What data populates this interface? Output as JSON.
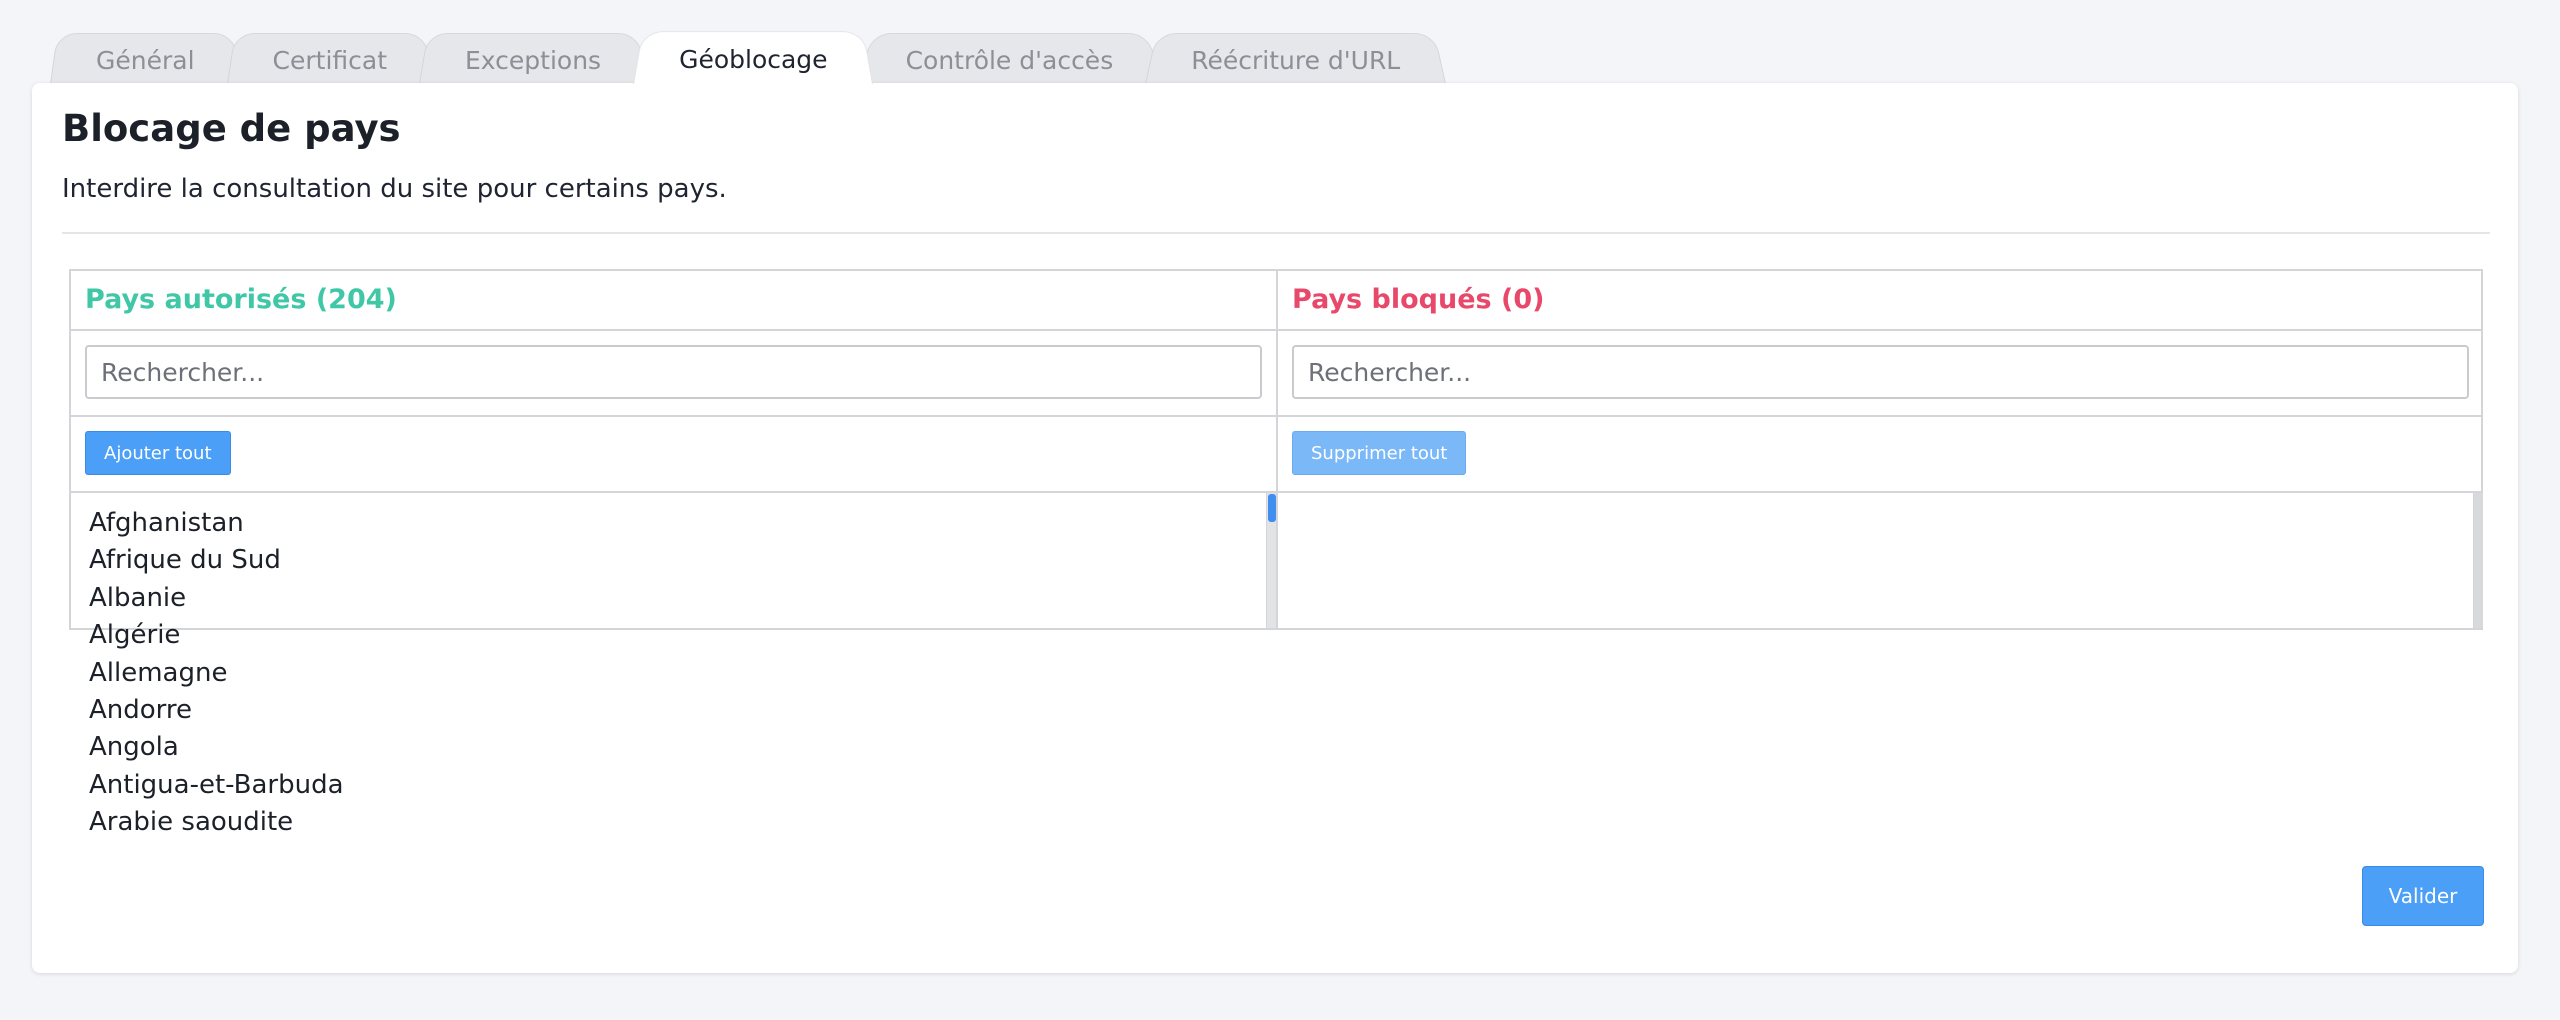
{
  "tabs": [
    {
      "label": "Général",
      "active": false
    },
    {
      "label": "Certificat",
      "active": false
    },
    {
      "label": "Exceptions",
      "active": false
    },
    {
      "label": "Géoblocage",
      "active": true
    },
    {
      "label": "Contrôle d'accès",
      "active": false
    },
    {
      "label": "Réécriture d'URL",
      "active": false
    }
  ],
  "section": {
    "title": "Blocage de pays",
    "description": "Interdire la consultation du site pour certains pays."
  },
  "allowed": {
    "title": "Pays autorisés (204)",
    "search_placeholder": "Rechercher...",
    "action_label": "Ajouter tout",
    "items": [
      "Afghanistan",
      "Afrique du Sud",
      "Albanie",
      "Algérie",
      "Allemagne",
      "Andorre",
      "Angola",
      "Antigua-et-Barbuda",
      "Arabie saoudite"
    ]
  },
  "blocked": {
    "title": "Pays bloqués (0)",
    "search_placeholder": "Rechercher...",
    "action_label": "Supprimer tout",
    "items": []
  },
  "submit_label": "Valider",
  "colors": {
    "allowed_title": "#3fc7a6",
    "blocked_title": "#e8486a",
    "primary_button": "#4b9ff7"
  }
}
